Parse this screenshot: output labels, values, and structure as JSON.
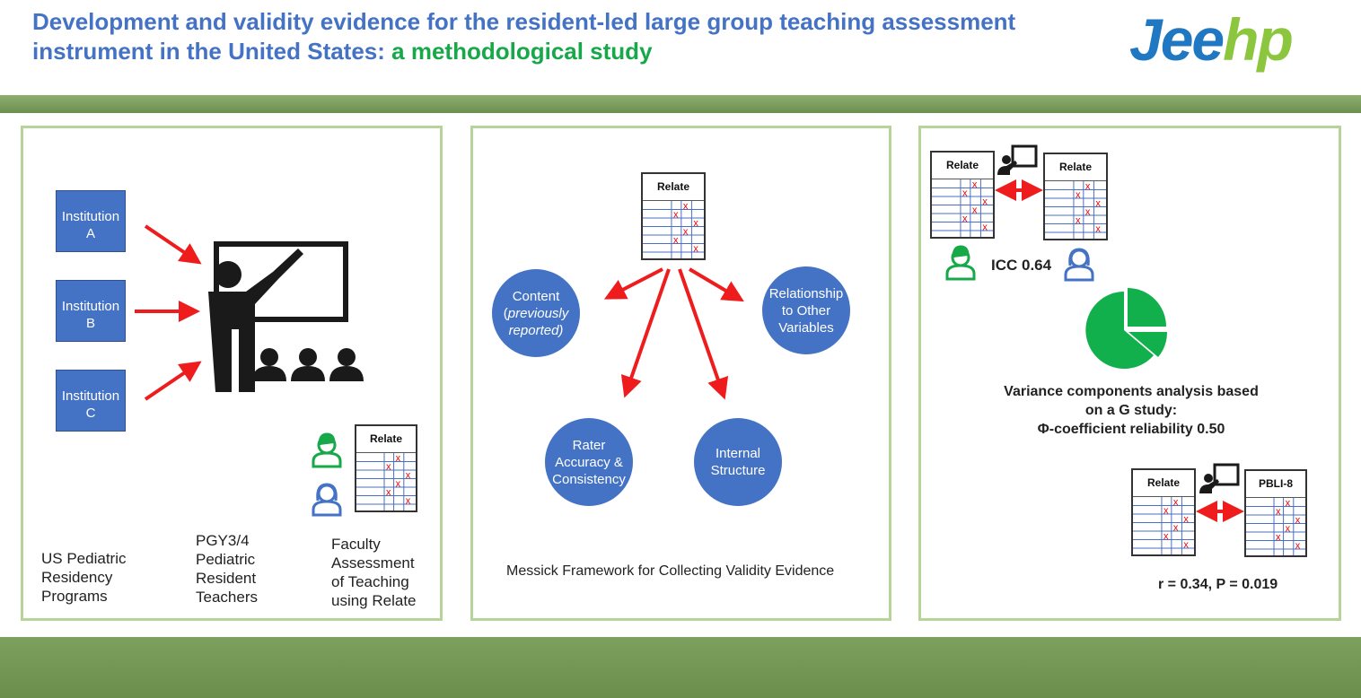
{
  "header": {
    "title_part1": "Development and validity evidence for the resident-led large group teaching assessment instrument in the United States: ",
    "title_part2": "a methodological study",
    "logo_text": "Jeehp",
    "logo_part1": "Jee",
    "logo_part2": "hp"
  },
  "colors": {
    "title_blue": "#4472c4",
    "title_green": "#17a84a",
    "band_green": "#7a9c5c",
    "panel_border": "#b6d39a",
    "box_blue": "#4472c4",
    "arrow_red": "#ee1c1c",
    "pie_green": "#12b04c"
  },
  "panel1": {
    "institutions": [
      {
        "label": "Institution",
        "letter": "A"
      },
      {
        "label": "Institution",
        "letter": "B"
      },
      {
        "label": "Institution",
        "letter": "C"
      }
    ],
    "form_title": "Relate",
    "captions": {
      "programs": "US Pediatric Residency Programs",
      "teachers": "PGY3/4 Pediatric Resident Teachers",
      "faculty": "Faculty Assessment of Teaching using Relate"
    }
  },
  "panel2": {
    "form_title": "Relate",
    "circles": {
      "content_line1": "Content",
      "content_line2": "previously",
      "content_line3": "reported)",
      "relationship": "Relationship to Other Variables",
      "rater": "Rater Accuracy & Consistency",
      "internal": "Internal Structure"
    },
    "caption": "Messick Framework for Collecting Validity Evidence"
  },
  "panel3": {
    "form_left_title": "Relate",
    "form_right_title": "Relate",
    "icc": "ICC 0.64",
    "variance_line1": "Variance components analysis based",
    "variance_line2": "on a G study:",
    "variance_line3": "Φ-coefficient reliability 0.50",
    "form_bottom_left_title": "Relate",
    "form_bottom_right_title": "PBLI-8",
    "correlation": "r = 0.34, P = 0.019"
  }
}
